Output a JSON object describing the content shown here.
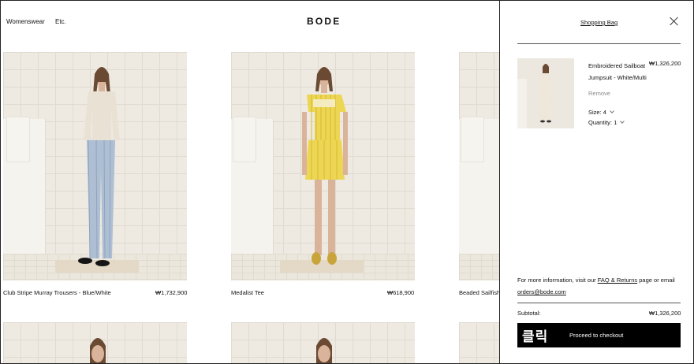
{
  "header": {
    "nav": [
      "Womenswear",
      "Etc."
    ],
    "logo": "BODE"
  },
  "products": [
    {
      "name": "Club Stripe Murray Trousers - Blue/White",
      "price": "₩1,732,900"
    },
    {
      "name": "Medalist Tee",
      "price": "₩618,900"
    },
    {
      "name": "Beaded Sailfish",
      "price": ""
    }
  ],
  "bag": {
    "title": "Shopping Bag",
    "item": {
      "name": "Embroidered Sailboat Jumpsuit - White/Multi",
      "price": "₩1,326,200",
      "remove_label": "Remove",
      "size": "Size: 4",
      "quantity": "Quantity: 1"
    },
    "info": {
      "prefix": "For more information, visit our",
      "faq_link": "FAQ & Returns",
      "middle": "page or email",
      "email": "orders@bode.com"
    },
    "subtotal_label": "Subtotal:",
    "subtotal_value": "₩1,326,200",
    "click_badge": "클릭",
    "checkout_label": "Proceed to checkout"
  },
  "icons": {
    "close": "close-icon",
    "chevron": "chevron-down-icon"
  }
}
